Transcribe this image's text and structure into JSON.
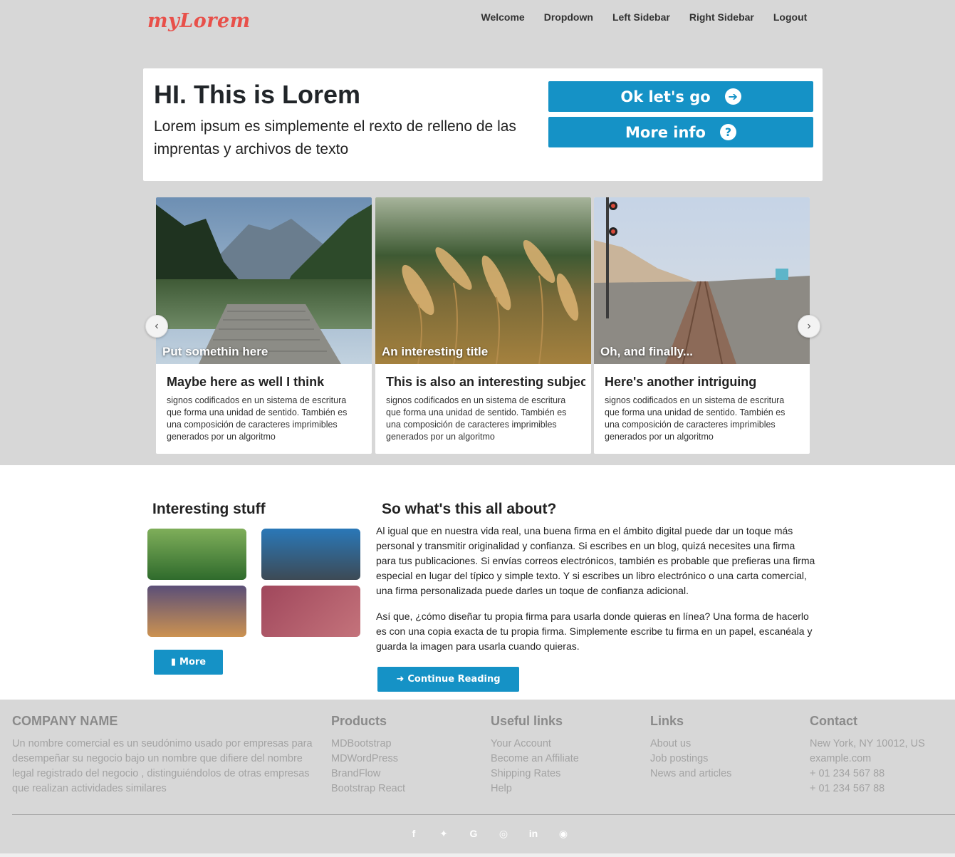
{
  "brand": {
    "logo": "myLorem",
    "color": "#e8504a"
  },
  "nav": {
    "items": [
      "Welcome",
      "Dropdown",
      "Left Sidebar",
      "Right Sidebar",
      "Logout"
    ]
  },
  "hero": {
    "title": "HI. This is Lorem",
    "subtitle": "Lorem ipsum es simplemente el rexto de relleno de las imprentas y archivos de texto",
    "go_label": "Ok let's go",
    "info_label": "More info",
    "accent": "#1592c6"
  },
  "carousel": {
    "cards": [
      {
        "caption": "Put somethin here",
        "title": "Maybe here as well I think",
        "text": "signos codificados en un sistema de escritura que forma una unidad de sentido. También es una composición de caracteres imprimibles generados por un algoritmo",
        "image": "lake-dock-image"
      },
      {
        "caption": "An interesting title",
        "title": "This is also an interesting subject",
        "text": "signos codificados en un sistema de escritura que forma una unidad de sentido. También es una composición de caracteres imprimibles generados por un algoritmo",
        "image": "wheat-field-image"
      },
      {
        "caption": "Oh, and finally...",
        "title": "Here's another intriguing",
        "text": "signos codificados en un sistema de escritura que forma una unidad de sentido. También es una composición de caracteres imprimibles generados por un algoritmo",
        "image": "railway-image"
      }
    ]
  },
  "interesting": {
    "title": "Interesting stuff",
    "more_label": "More",
    "tiles": [
      "green-gradient",
      "blue-gradient",
      "purple-orange-gradient",
      "rose-gradient"
    ]
  },
  "about": {
    "title": "So what's this all about?",
    "para1": "Al igual que en nuestra vida real, una buena firma en el ámbito digital puede dar un toque más personal y transmitir originalidad y confianza. Si escribes en un blog, quizá necesites una firma para tus publicaciones. Si envías correos electrónicos, también es probable que prefieras una firma especial en lugar del típico y simple texto. Y si escribes un libro electrónico o una carta comercial, una firma personalizada puede darles un toque de confianza adicional.",
    "para2": "Así que, ¿cómo diseñar tu propia firma para usarla donde quieras en línea? Una forma de hacerlo es con una copia exacta de tu propia firma. Simplemente escribe tu firma en un papel, escanéala y guarda la imagen para usarla cuando quieras.",
    "continue_label": "Continue Reading"
  },
  "footer": {
    "company": {
      "title": "COMPANY NAME",
      "text": "Un nombre comercial es un seudónimo usado por empresas para desempeñar su negocio bajo un nombre que difiere del nombre legal registrado del negocio , distinguiéndolos de otras empresas que realizan actividades similares"
    },
    "products": {
      "title": "Products",
      "items": [
        "MDBootstrap",
        "MDWordPress",
        "BrandFlow",
        "Bootstrap React"
      ]
    },
    "useful": {
      "title": "Useful links",
      "items": [
        "Your Account",
        "Become an Affiliate",
        "Shipping Rates",
        "Help"
      ]
    },
    "links": {
      "title": "Links",
      "items": [
        "About us",
        "Job postings",
        "News and articles"
      ]
    },
    "contact": {
      "title": "Contact",
      "items": [
        "New York, NY 10012, US",
        "example.com",
        "+ 01 234 567 88",
        "+ 01 234 567 88"
      ]
    },
    "social": [
      "facebook-icon",
      "twitter-icon",
      "google-icon",
      "instagram-icon",
      "linkedin-icon",
      "github-icon"
    ]
  }
}
